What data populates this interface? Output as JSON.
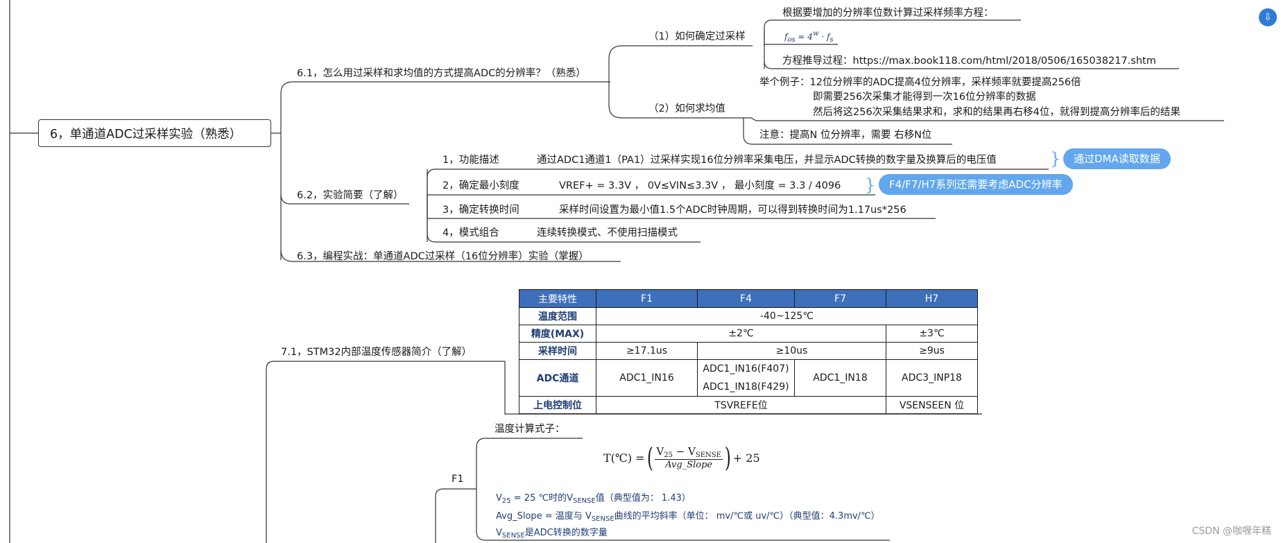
{
  "root": {
    "label": "6，单通道ADC过采样实验（熟悉）"
  },
  "s61": {
    "label": "6.1，怎么用过采样和求均值的方式提高ADC的分辨率？（熟悉）",
    "q1": {
      "label": "（1）如何确定过采样",
      "line1": "根据要增加的分辨率位数计算过采样频率方程：",
      "formula_lhs": "f",
      "formula_lhs_sub": "os",
      "formula_mid": " = 4",
      "formula_sup": "w",
      "formula_rhs": " · f",
      "formula_rhs_sub": "s",
      "line3": "方程推导过程：https://max.book118.com/html/2018/0506/165038217.shtm"
    },
    "q2": {
      "label": "（2）如何求均值",
      "example1": "举个例子：12位分辨率的ADC提高4位分辨率，采样频率就要提高256倍",
      "example2": "即需要256次采集才能得到一次16位分辨率的数据",
      "example3": "然后将这256次采集结果求和，求和的结果再右移4位，就得到提高分辨率后的结果",
      "note": "注意：提高N 位分辨率，需要 右移N位"
    }
  },
  "s62": {
    "label": "6.2，实验简要（了解）",
    "items": [
      {
        "label": "1，功能描述",
        "desc": "通过ADC1通道1（PA1）过采样实现16位分辨率采集电压，并显示ADC转换的数字量及换算后的电压值"
      },
      {
        "label": "2，确定最小刻度",
        "desc": "VREF+ = 3.3V ， 0V≤VIN≤3.3V ， 最小刻度 = 3.3 / 4096"
      },
      {
        "label": "3，确定转换时间",
        "desc": "采样时间设置为最小值1.5个ADC时钟周期，可以得到转换时间为1.17us*256"
      },
      {
        "label": "4，模式组合",
        "desc": "连续转换模式、不使用扫描模式"
      }
    ],
    "callout1": "通过DMA读取数据",
    "callout2": "F4/F7/H7系列还需要考虑ADC分辨率"
  },
  "s63": {
    "label": "6.3，编程实战：单通道ADC过采样（16位分辨率）实验（掌握）"
  },
  "s71": {
    "label": "7.1，STM32内部温度传感器简介（了解）",
    "table": {
      "headers": [
        "主要特性",
        "F1",
        "F4",
        "F7",
        "H7"
      ],
      "temp_label": "温度范围",
      "temp_value": "-40~125℃",
      "acc_label": "精度(MAX)",
      "acc_f1f7": "±2℃",
      "acc_h7": "±3℃",
      "samp_label": "采样时间",
      "samp_f1": "≥17.1us",
      "samp_f4f7": "≥10us",
      "samp_h7": "≥9us",
      "ch_label": "ADC通道",
      "ch_f1": "ADC1_IN16",
      "ch_f4_a": "ADC1_IN16(F407)",
      "ch_f4_b": "ADC1_IN18(F429)",
      "ch_f7": "ADC1_IN18",
      "ch_h7": "ADC3_INP18",
      "pwr_label": "上电控制位",
      "pwr_f1f7": "TSVREFE位",
      "pwr_h7": "VSENSEEN 位"
    }
  },
  "f1": {
    "label": "F1",
    "formula_title": "温度计算式子：",
    "formula_T": "T(℃) = ",
    "formula_num_v25": "V",
    "formula_num_v25_sub": "25",
    "formula_minus": " − V",
    "formula_vsense_sub": "SENSE",
    "formula_den": "Avg_Slope",
    "formula_plus": " + 25",
    "note1_a": "V",
    "note1_sub": "25",
    "note1_b": " = 25 ℃时的V",
    "note1_sub2": "SENSE",
    "note1_c": "值（典型值为： 1.43）",
    "note2_a": "Avg_Slope = 温度与 V",
    "note2_sub": "SENSE",
    "note2_b": "曲线的平均斜率（单位： mv/℃或 uv/℃）（典型值：4.3mv/℃）",
    "note3_a": "V",
    "note3_sub": "SENSE",
    "note3_b": "是ADC转换的数字量"
  },
  "watermark": "CSDN @咖喱年糕"
}
